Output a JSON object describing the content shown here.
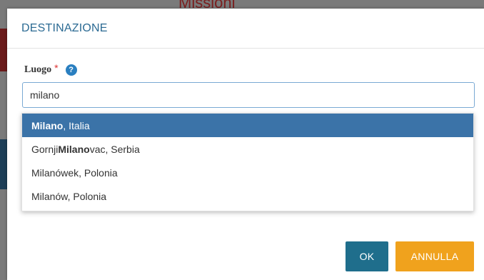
{
  "background": {
    "page_title": "Missioni"
  },
  "modal": {
    "title": "DESTINAZIONE",
    "field_label": "Luogo",
    "required_mark": "*",
    "help_icon": "?",
    "input_value": "milano"
  },
  "dropdown": {
    "items": [
      {
        "prefix": "",
        "match": "Milano",
        "suffix": ", Italia",
        "active": true
      },
      {
        "prefix": "Gornji ",
        "match": "Milano",
        "suffix": "vac, Serbia",
        "active": false
      },
      {
        "prefix": "Milanówek, Polonia",
        "match": "",
        "suffix": "",
        "active": false
      },
      {
        "prefix": "Milanów, Polonia",
        "match": "",
        "suffix": "",
        "active": false
      }
    ]
  },
  "buttons": {
    "ok_label": "OK",
    "cancel_label": "ANNULLA"
  },
  "colors": {
    "accent": "#2b6a93",
    "active_item": "#3b73a8",
    "ok_button": "#1f6e8c",
    "cancel_button": "#f0a21d",
    "help_icon": "#2a7fc0"
  }
}
